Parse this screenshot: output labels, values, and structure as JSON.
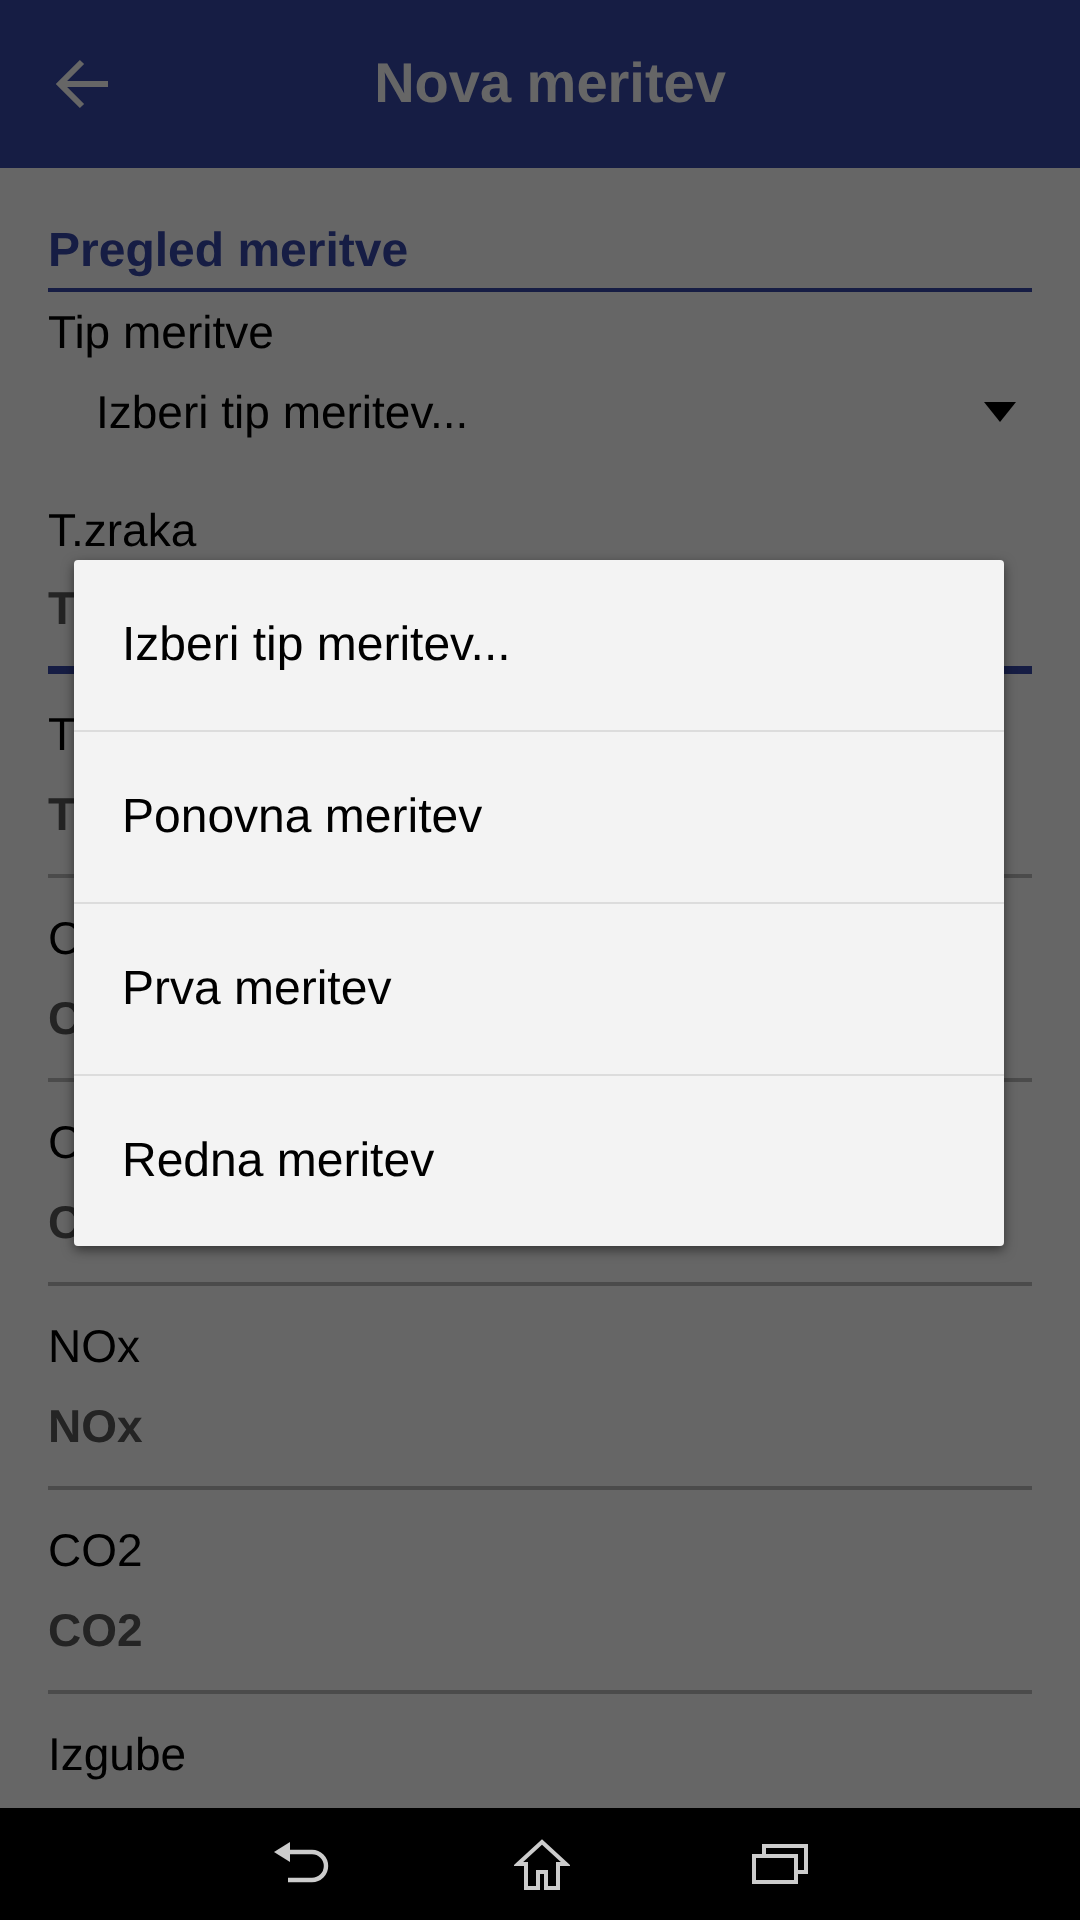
{
  "app_bar": {
    "title": "Nova meritev"
  },
  "section": {
    "title": "Pregled meritve"
  },
  "spinner": {
    "label": "Tip meritve",
    "value": "Izberi tip meritev..."
  },
  "fields": [
    {
      "label": "T.zraka",
      "placeholder": "T",
      "focused": true
    },
    {
      "label": "T",
      "placeholder": "T",
      "focused": false
    },
    {
      "label": "C",
      "placeholder": "C",
      "focused": false
    },
    {
      "label": "C",
      "placeholder": "C",
      "focused": false
    },
    {
      "label": "NOx",
      "placeholder": "NOx",
      "focused": false
    },
    {
      "label": "CO2",
      "placeholder": "CO2",
      "focused": false
    },
    {
      "label": "Izgube"
    }
  ],
  "dropdown": {
    "options": [
      {
        "label": "Izberi tip meritev..."
      },
      {
        "label": "Ponovna meritev"
      },
      {
        "label": "Prva meritev"
      },
      {
        "label": "Redna meritev"
      }
    ]
  }
}
